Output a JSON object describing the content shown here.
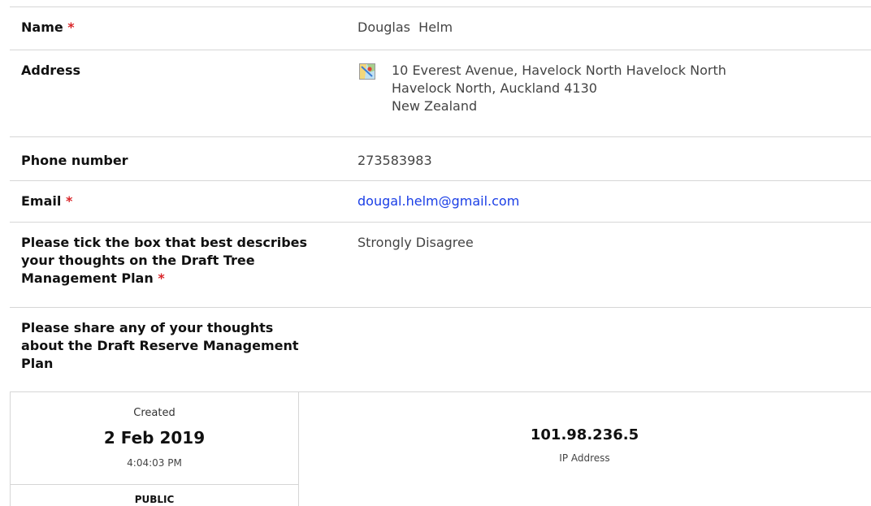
{
  "fields": {
    "name": {
      "label": "Name",
      "required": "*",
      "value": "Douglas  Helm"
    },
    "address": {
      "label": "Address",
      "icon": "map-icon",
      "lines": [
        "10 Everest Avenue, Havelock North Havelock North",
        "Havelock North, Auckland 4130",
        "New Zealand"
      ]
    },
    "phone": {
      "label": "Phone number",
      "value": "273583983"
    },
    "email": {
      "label": "Email",
      "required": "*",
      "value": "dougal.helm@gmail.com"
    },
    "opinion": {
      "label_lines": [
        "Please tick the box that best describes",
        "your thoughts on the Draft Tree",
        "Management Plan"
      ],
      "required": "*",
      "value": "Strongly Disagree"
    },
    "thoughts": {
      "label_lines": [
        "Please share any of your thoughts",
        "about the Draft Reserve Management",
        "Plan"
      ],
      "value": ""
    }
  },
  "meta": {
    "created_label": "Created",
    "created_date": "2 Feb 2019",
    "created_time": "4:04:03 PM",
    "visibility": "PUBLIC",
    "ip_address": "101.98.236.5",
    "ip_label": "IP Address"
  },
  "colors": {
    "required": "#d9262a",
    "link": "#1a3ee6",
    "divider": "#d6d6d6"
  }
}
